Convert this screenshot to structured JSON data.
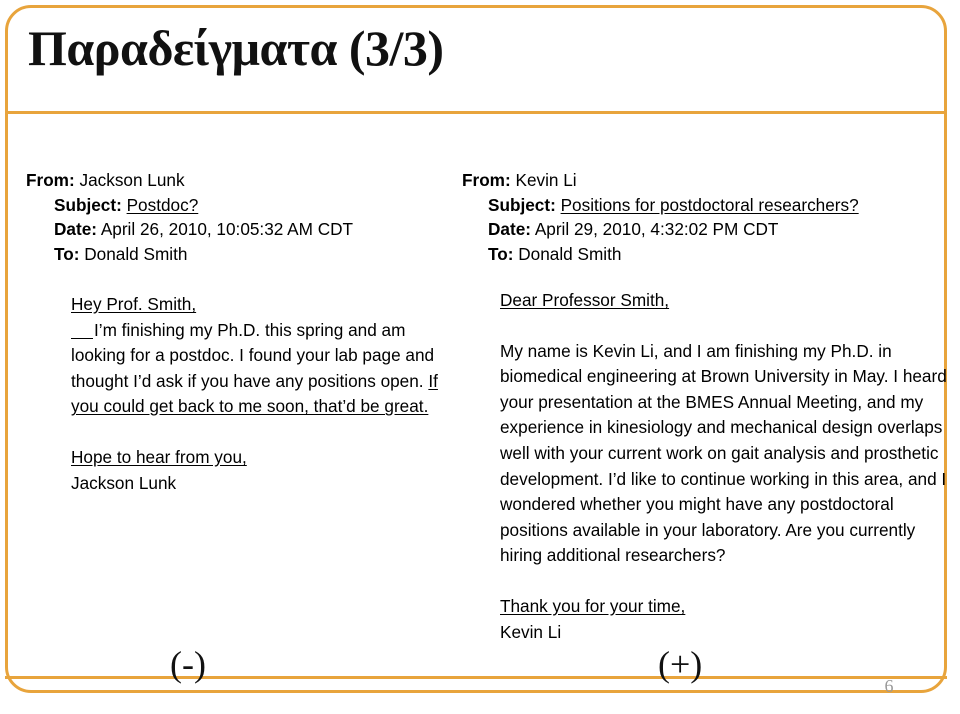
{
  "slide": {
    "title": "Παραδείγματα (3/3)",
    "page_number": "6",
    "accent_color": "#E8A43C",
    "background_color": "#FFFFFF",
    "text_color": "#000000",
    "page_number_color": "#9A9A9A"
  },
  "markers": {
    "negative": "(-)",
    "positive": "(+)"
  },
  "emails": {
    "left": {
      "header": {
        "from_label": "From:",
        "from_value": "Jackson Lunk",
        "subject_label": "Subject:",
        "subject_value": "Postdoc?",
        "date_label": "Date:",
        "date_value": "April 26, 2010, 10:05:32 AM CDT",
        "to_label": "To:",
        "to_value": "Donald Smith"
      },
      "body": {
        "greeting": "Hey Prof. Smith,",
        "paragraph_plain_1": "I’m finishing my Ph.D. this spring and am looking for a postdoc. I found your lab page and thought I’d ask if you have any positions open. ",
        "paragraph_underlined_1": "If you could get back to me soon, that’d be great.",
        "closing": "Hope to hear from you,",
        "signature": "Jackson Lunk"
      }
    },
    "right": {
      "header": {
        "from_label": "From:",
        "from_value": "Kevin Li",
        "subject_label": "Subject:",
        "subject_value": "Positions for postdoctoral researchers?",
        "date_label": "Date:",
        "date_value": "April 29, 2010, 4:32:02 PM CDT",
        "to_label": "To:",
        "to_value": "Donald Smith"
      },
      "body": {
        "greeting": "Dear Professor Smith,",
        "paragraph_1": "My name is Kevin Li, and I am finishing my Ph.D. in biomedical engineering at Brown University in May. I heard your presentation at the BMES Annual Meeting, and my experience in kinesiology and mechanical design overlaps well with your current work on gait analysis and prosthetic development. I’d like to continue working in this area, and I wondered whether you might have any postdoctoral positions available in your laboratory. Are you currently hiring additional researchers?",
        "closing": "Thank you for your time,",
        "signature": "Kevin Li"
      }
    }
  }
}
